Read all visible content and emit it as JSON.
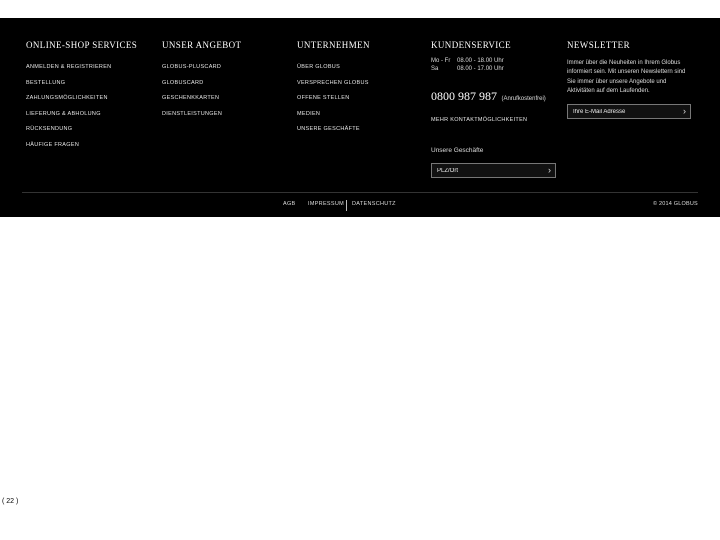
{
  "columns": [
    {
      "title": "ONLINE-SHOP SERVICES",
      "links": [
        "ANMELDEN & REGISTRIEREN",
        "BESTELLUNG",
        "ZAHLUNGSMÖGLICHKEITEN",
        "LIEFERUNG & ABHOLUNG",
        "RÜCKSENDUNG",
        "HÄUFIGE FRAGEN"
      ]
    },
    {
      "title": "UNSER ANGEBOT",
      "links": [
        "GLOBUS-PLUSCARD",
        "GLOBUSCARD",
        "GESCHENKKARTEN",
        "DIENSTLEISTUNGEN"
      ]
    },
    {
      "title": "UNTERNEHMEN",
      "links": [
        "ÜBER GLOBUS",
        "VERSPRECHEN GLOBUS",
        "OFFENE STELLEN",
        "MEDIEN",
        "UNSERE GESCHÄFTE"
      ]
    }
  ],
  "service": {
    "title": "KUNDENSERVICE",
    "hours": [
      {
        "day": "Mo - Fr",
        "time": "08.00 - 18.00 Uhr"
      },
      {
        "day": "Sa",
        "time": "08.00 - 17.00 Uhr"
      }
    ],
    "phone": "0800 987 987",
    "phone_note": "(Anrufkostenfrei)",
    "more_contact": "MEHR KONTAKTMÖGLICHKEITEN",
    "stores_label": "Unsere Geschäfte",
    "zip_placeholder": "PLZ/Ort"
  },
  "newsletter": {
    "title": "NEWSLETTER",
    "text": "Immer über die Neuheiten in Ihrem Globus informiert sein. Mit unseren Newslettern sind Sie immer über unsere Angebote und Aktivitäten auf dem Laufenden.",
    "email_placeholder": "Ihre E-Mail Adresse"
  },
  "legal": {
    "agb": "AGB",
    "impressum": "IMPRESSUM",
    "datenschutz": "DATENSCHUTZ",
    "copyright": "© 2014 GLOBUS"
  },
  "page_number": "( 22 )",
  "colors": {
    "footer_background": "#000000",
    "text": "#ffffff",
    "page_background": "#ffffff"
  },
  "icons": {
    "chevron": "chevron-right-icon"
  }
}
